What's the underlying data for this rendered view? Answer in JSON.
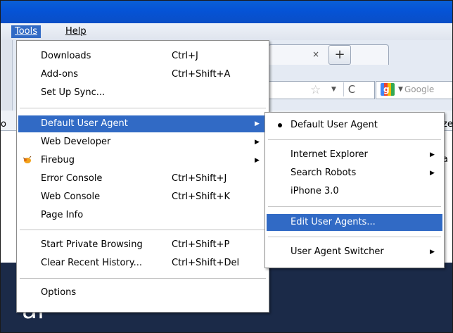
{
  "menubar": {
    "tools": "Tools",
    "help": "Help"
  },
  "tools_menu": {
    "items": [
      {
        "label": "Downloads",
        "accel": "Ctrl+J"
      },
      {
        "label": "Add-ons",
        "accel": "Ctrl+Shift+A"
      },
      {
        "label": "Set Up Sync...",
        "accel": ""
      },
      {
        "label": "Default User Agent",
        "accel": "",
        "submenu": true
      },
      {
        "label": "Web Developer",
        "accel": "",
        "submenu": true
      },
      {
        "label": "Firebug",
        "accel": "",
        "submenu": true
      },
      {
        "label": "Error Console",
        "accel": "Ctrl+Shift+J"
      },
      {
        "label": "Web Console",
        "accel": "Ctrl+Shift+K"
      },
      {
        "label": "Page Info",
        "accel": ""
      },
      {
        "label": "Start Private Browsing",
        "accel": "Ctrl+Shift+P"
      },
      {
        "label": "Clear Recent History...",
        "accel": "Ctrl+Shift+Del"
      },
      {
        "label": "Options",
        "accel": ""
      }
    ]
  },
  "ua_submenu": {
    "items": [
      {
        "label": "Default User Agent",
        "checked": true
      },
      {
        "label": "Internet Explorer",
        "submenu": true
      },
      {
        "label": "Search Robots",
        "submenu": true
      },
      {
        "label": "iPhone 3.0"
      },
      {
        "label": "Edit User Agents..."
      },
      {
        "label": "User Agent Switcher",
        "submenu": true
      }
    ]
  },
  "browser": {
    "tab_close": "×",
    "new_tab": "+",
    "search_placeholder": "Google",
    "google_logo_letter": "g",
    "bg_text_left": "o",
    "bg_text_right_top": "ze",
    "bg_text_right_mid": "a",
    "dark_glyph": "al"
  },
  "colors": {
    "highlight": "#316ac5",
    "titlebar": "#0553d6",
    "dark_bg": "#1b2a48"
  },
  "icons": {
    "submenu_arrow": "triangle-right",
    "checked": "bullet",
    "firebug": "firebug-icon",
    "star": "bookmark-star-icon",
    "reload": "reload-icon"
  }
}
